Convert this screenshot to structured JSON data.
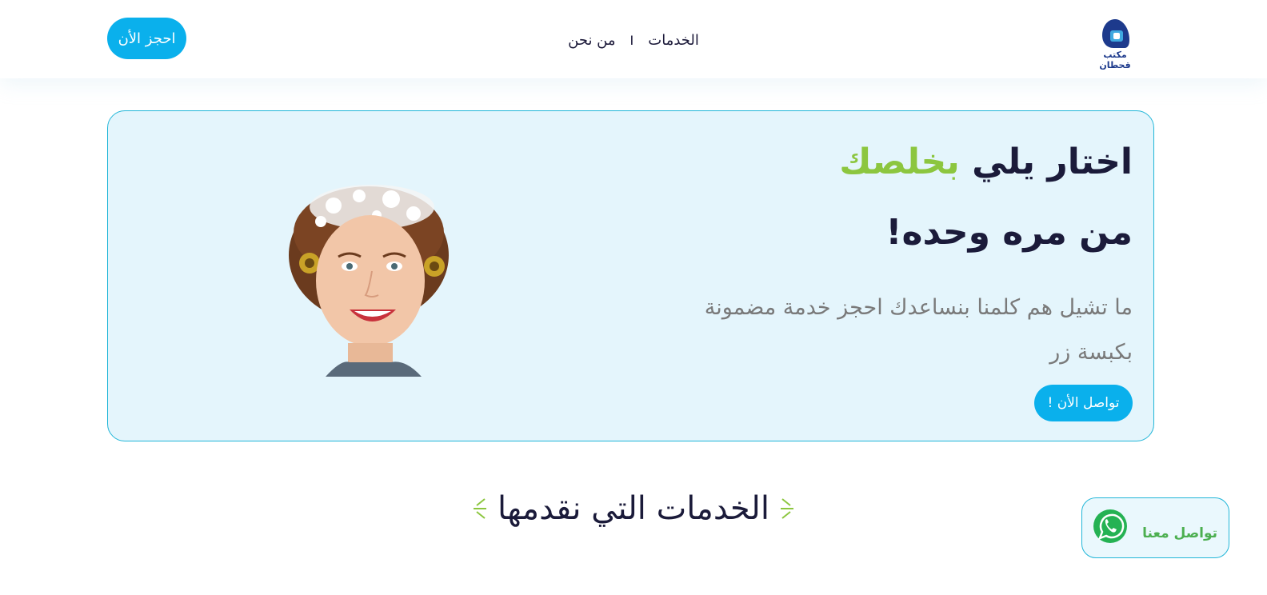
{
  "header": {
    "logo_text": "مكتب قحطان",
    "nav": [
      {
        "label": "الخدمات"
      },
      {
        "label": "من نحن"
      }
    ],
    "separator": "I",
    "book_button": "احجز الأن"
  },
  "hero": {
    "title_part1": "اختار يلي ",
    "title_accent": "بخلصك",
    "title_line2": "من مره وحده!",
    "description": "ما تشيل هم كلمنا بنساعدك احجز خدمة مضمونة بكبسة زر",
    "contact_button": "تواصل الأن !"
  },
  "services": {
    "title": "الخدمات التي نقدمها"
  },
  "whatsapp": {
    "label": "تواصل معنا"
  },
  "colors": {
    "primary": "#0ab0ec",
    "accent_green": "#8cc63f",
    "hero_bg": "#e4f5fc",
    "border": "#21b6d8",
    "dark_text": "#1b1b3a",
    "whatsapp": "#4caf50"
  },
  "icons": [
    "logo-icon",
    "whatsapp-icon",
    "spark-icon"
  ]
}
